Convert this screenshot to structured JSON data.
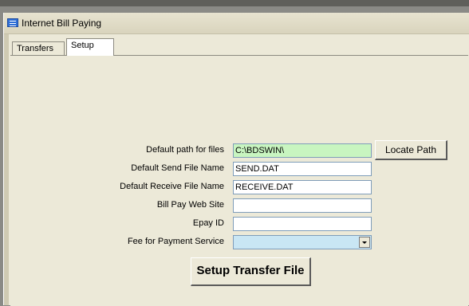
{
  "window": {
    "title": "Internet Bill Paying"
  },
  "tabs": [
    {
      "label": "Transfers"
    },
    {
      "label": "Setup"
    }
  ],
  "form": {
    "default_path": {
      "label": "Default path for files",
      "value": "C:\\BDSWIN\\"
    },
    "send_file": {
      "label": "Default Send File Name",
      "value": "SEND.DAT"
    },
    "receive_file": {
      "label": "Default Receive File Name",
      "value": "RECEIVE.DAT"
    },
    "web_site": {
      "label": "Bill Pay Web Site",
      "value": ""
    },
    "epay_id": {
      "label": "Epay ID",
      "value": ""
    },
    "fee": {
      "label": "Fee for Payment Service",
      "value": ""
    }
  },
  "buttons": {
    "locate_path": "Locate Path",
    "setup_transfer": "Setup Transfer File"
  },
  "colors": {
    "path_field": "#c8f5c0",
    "fee_field": "#c9e6f4",
    "window_bg": "#ece9d8"
  }
}
